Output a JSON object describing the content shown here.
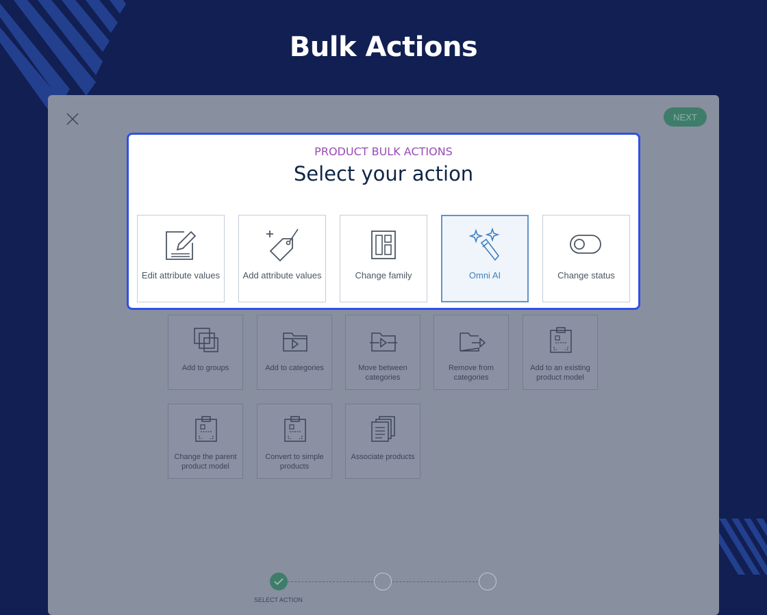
{
  "page": {
    "title": "Bulk Actions"
  },
  "panel": {
    "next_label": "NEXT",
    "close_icon": "close-icon",
    "tiles": [
      {
        "label": "Add to groups",
        "icon": "groups-icon"
      },
      {
        "label": "Add to categories",
        "icon": "folder-add-icon"
      },
      {
        "label": "Move between categories",
        "icon": "folder-move-icon"
      },
      {
        "label": "Remove from categories",
        "icon": "folder-remove-icon"
      },
      {
        "label": "Add to an existing product model",
        "icon": "product-model-icon"
      },
      {
        "label": "Change the parent product model",
        "icon": "product-model-icon"
      },
      {
        "label": "Convert to simple products",
        "icon": "product-model-icon"
      },
      {
        "label": "Associate products",
        "icon": "documents-icon"
      }
    ],
    "stepper": {
      "steps": [
        {
          "label": "SELECT ACTION",
          "state": "done"
        },
        {
          "state": "pending"
        },
        {
          "state": "pending"
        }
      ]
    }
  },
  "modal": {
    "subtitle": "PRODUCT BULK ACTIONS",
    "title": "Select your action",
    "actions": [
      {
        "label": "Edit attribute values",
        "icon": "edit-icon"
      },
      {
        "label": "Add attribute values",
        "icon": "tag-add-icon"
      },
      {
        "label": "Change family",
        "icon": "family-icon"
      },
      {
        "label": "Omni AI",
        "icon": "magic-wand-icon",
        "selected": true
      },
      {
        "label": "Change status",
        "icon": "toggle-icon"
      }
    ]
  },
  "colors": {
    "background": "#121f52",
    "modal_border": "#2f50e5",
    "subtitle": "#9a4ab6",
    "selected_accent": "#5f93cc",
    "step_done": "#3e7d69"
  }
}
